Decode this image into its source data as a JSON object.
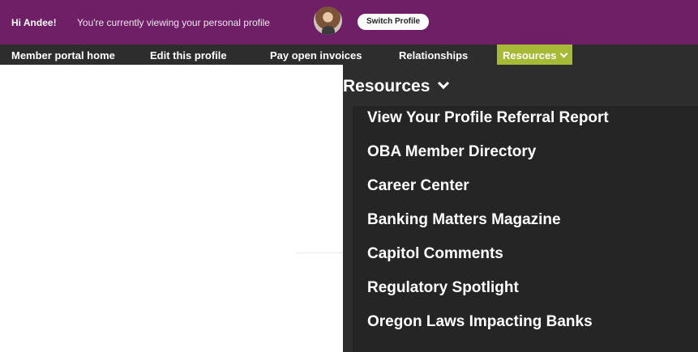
{
  "profile_bar": {
    "greeting": "Hi Andee!",
    "viewing_text": "You're currently viewing your personal profile",
    "switch_label": "Switch Profile"
  },
  "nav": {
    "items": [
      {
        "label": "Member portal home"
      },
      {
        "label": "Edit this profile"
      },
      {
        "label": "Pay open invoices"
      },
      {
        "label": "Relationships"
      },
      {
        "label": "Resources"
      }
    ]
  },
  "dropdown": {
    "header": "Resources",
    "items": [
      {
        "label": "View Your Profile Referral Report"
      },
      {
        "label": "OBA Member Directory"
      },
      {
        "label": "Career Center"
      },
      {
        "label": "Banking Matters Magazine"
      },
      {
        "label": "Capitol Comments"
      },
      {
        "label": "Regulatory Spotlight"
      },
      {
        "label": "Oregon Laws Impacting Banks"
      }
    ]
  },
  "colors": {
    "profile_bar": "#6e1f66",
    "nav_bar": "#2d2d2d",
    "active_item": "#a7ba35",
    "dropdown": "#2d2d2d"
  }
}
